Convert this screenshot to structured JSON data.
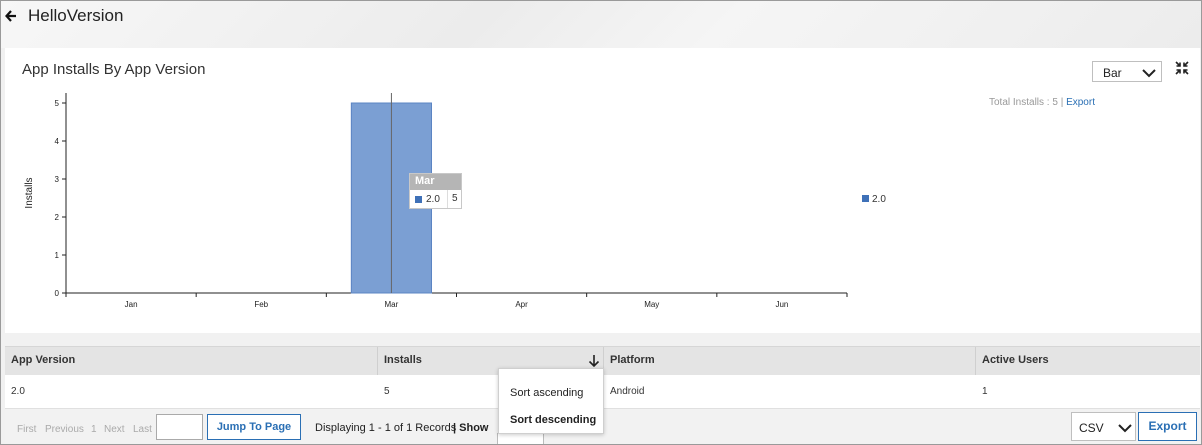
{
  "header": {
    "title": "HelloVersion"
  },
  "panel": {
    "title": "App Installs By App Version",
    "chart_type_select": "Bar",
    "total_label": "Total Installs : 5 |",
    "export_link": "Export"
  },
  "chart_data": {
    "type": "bar",
    "title": "App Installs By App Version",
    "categories": [
      "Jan",
      "Feb",
      "Mar",
      "Apr",
      "May",
      "Jun"
    ],
    "series": [
      {
        "name": "2.0",
        "values": [
          0,
          0,
          5,
          0,
          0,
          0
        ],
        "color": "#3f71b8"
      }
    ],
    "xlabel": "",
    "ylabel": "Installs",
    "ylim": [
      0,
      5
    ],
    "yticks": [
      "0",
      "1",
      "2",
      "3",
      "4",
      "5"
    ],
    "grid": false,
    "legend": "right"
  },
  "tooltip": {
    "category": "Mar",
    "series": "2.0",
    "value": "5"
  },
  "table": {
    "columns": [
      "App Version",
      "Installs",
      "Platform",
      "Active Users"
    ],
    "rows": [
      [
        "2.0",
        "5",
        "Android",
        "1"
      ]
    ]
  },
  "sort_menu": {
    "ascending": "Sort ascending",
    "descending": "Sort descending"
  },
  "footer": {
    "first": "First",
    "previous": "Previous",
    "page": "1",
    "next": "Next",
    "last": "Last",
    "jump_button": "Jump To Page",
    "records": "Displaying 1 - 1 of 1 Records",
    "show_label": "| Show",
    "format_select": "CSV",
    "export_button": "Export"
  },
  "colors": {
    "accent": "#2a6fb4",
    "bar": "#3f71b8"
  }
}
